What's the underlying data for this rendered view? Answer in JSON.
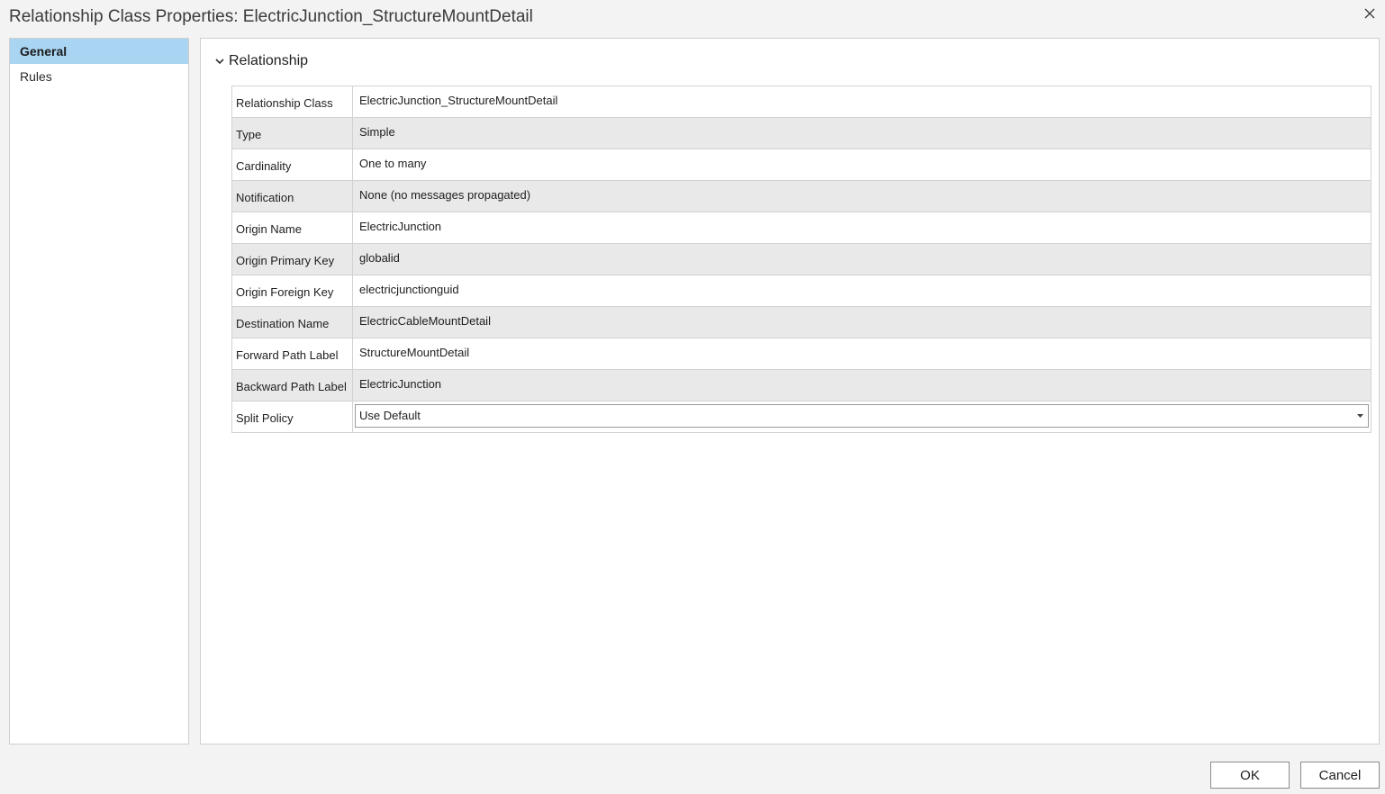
{
  "window": {
    "title": "Relationship Class Properties: ElectricJunction_StructureMountDetail"
  },
  "nav": {
    "items": [
      {
        "label": "General",
        "active": true
      },
      {
        "label": "Rules",
        "active": false
      }
    ]
  },
  "section": {
    "title": "Relationship"
  },
  "properties": [
    {
      "key": "Relationship Class",
      "value": "ElectricJunction_StructureMountDetail"
    },
    {
      "key": "Type",
      "value": "Simple"
    },
    {
      "key": "Cardinality",
      "value": "One to many"
    },
    {
      "key": "Notification",
      "value": "None (no messages propagated)"
    },
    {
      "key": "Origin Name",
      "value": "ElectricJunction"
    },
    {
      "key": "Origin Primary Key",
      "value": "globalid"
    },
    {
      "key": "Origin Foreign Key",
      "value": "electricjunctionguid"
    },
    {
      "key": "Destination Name",
      "value": "ElectricCableMountDetail"
    },
    {
      "key": "Forward Path Label",
      "value": "StructureMountDetail"
    },
    {
      "key": "Backward Path Label",
      "value": "ElectricJunction"
    },
    {
      "key": "Split Policy",
      "value": "Use Default"
    }
  ],
  "footer": {
    "ok_label": "OK",
    "cancel_label": "Cancel"
  },
  "icons": {
    "close": "close-icon",
    "section_toggle": "chevron-down-icon",
    "dropdown": "caret-down-icon"
  },
  "colors": {
    "nav_active": "#a9d5f2",
    "row_alt": "#e9e9e9",
    "background": "#f3f3f3"
  }
}
